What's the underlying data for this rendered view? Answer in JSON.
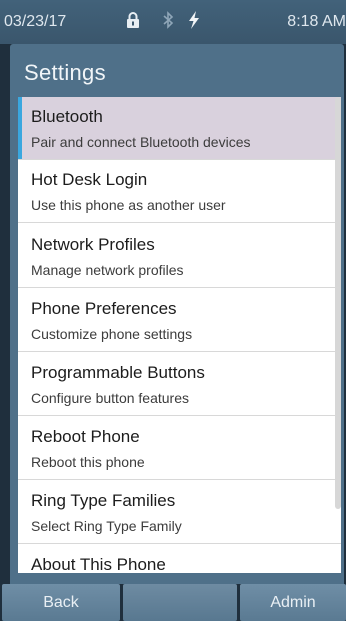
{
  "status": {
    "date": "03/23/17",
    "time": "8:18 AM",
    "icons": [
      "lock-icon",
      "bluetooth-icon",
      "power-icon"
    ]
  },
  "screen": {
    "title": "Settings"
  },
  "menu": {
    "items": [
      {
        "title": "Bluetooth",
        "subtitle": "Pair and connect Bluetooth devices"
      },
      {
        "title": "Hot Desk Login",
        "subtitle": "Use this phone as another user"
      },
      {
        "title": "Network Profiles",
        "subtitle": "Manage network profiles"
      },
      {
        "title": "Phone Preferences",
        "subtitle": "Customize phone settings"
      },
      {
        "title": "Programmable Buttons",
        "subtitle": "Configure button features"
      },
      {
        "title": "Reboot Phone",
        "subtitle": "Reboot this phone"
      },
      {
        "title": "Ring Type Families",
        "subtitle": "Select Ring Type Family"
      },
      {
        "title": "About This Phone",
        "subtitle": ""
      }
    ]
  },
  "softkeys": {
    "back": "Back",
    "middle": "",
    "admin": "Admin"
  },
  "colors": {
    "selection_accent": "#3aa7df",
    "selected_row": "#d9d1dd",
    "panel": "#4f7089"
  }
}
